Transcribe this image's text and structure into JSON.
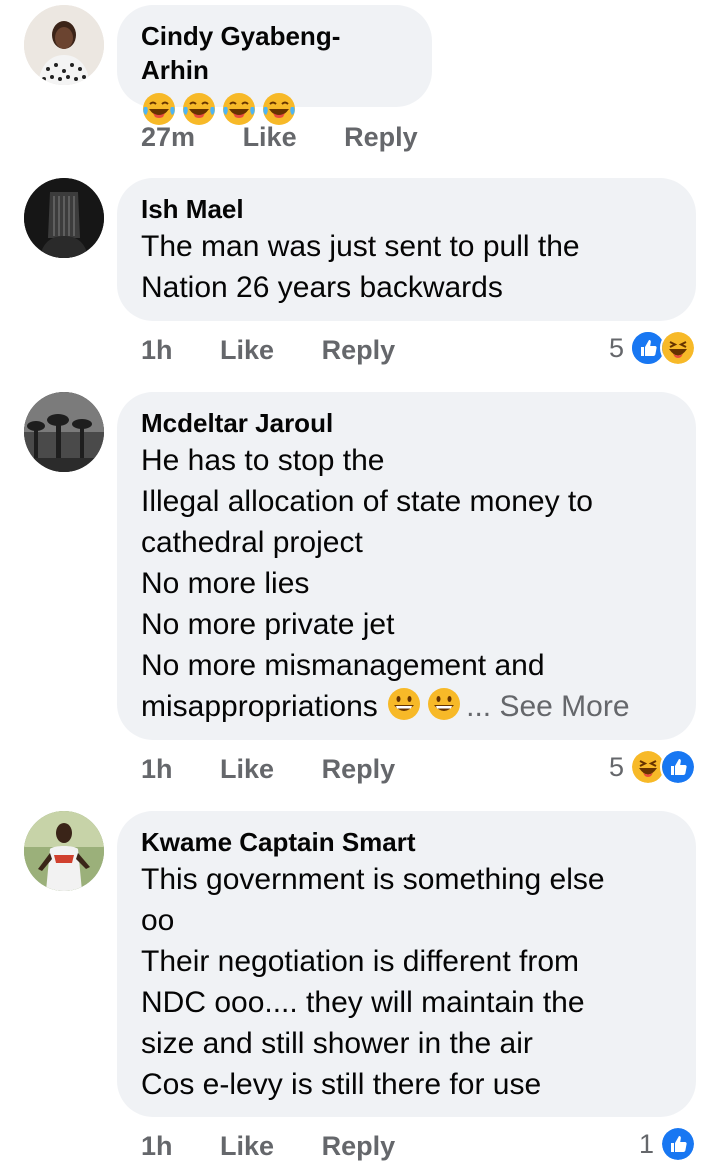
{
  "colors": {
    "bubble_bg": "#f0f2f5",
    "secondary_text": "#65676b",
    "like_blue": "#1877f2",
    "haha_yellow": "#f7b928"
  },
  "comments": [
    {
      "author": "Cindy Gyabeng-Arhin",
      "text": "",
      "emoji_only": [
        "laughing-tears-emoji",
        "laughing-tears-emoji",
        "laughing-tears-emoji",
        "laughing-tears-emoji"
      ],
      "time": "27m",
      "like": "Like",
      "reply": "Reply",
      "reaction_count": "",
      "reaction_icons": []
    },
    {
      "author": "Ish Mael",
      "text": "The man was just sent to pull the\nNation 26 years backwards",
      "time": "1h",
      "like": "Like",
      "reply": "Reply",
      "reaction_count": "5",
      "reaction_icons": [
        "like-icon",
        "haha-icon"
      ]
    },
    {
      "author": "Mcdeltar Jaroul",
      "text": "He has to stop the\nIllegal allocation of state money to\ncathedral project\nNo more lies\nNo more private jet\nNo more mismanagement and\nmisappropriations",
      "trailing_emojis": [
        "grinning-face-emoji",
        "grinning-face-emoji"
      ],
      "see_more": "... See More",
      "time": "1h",
      "like": "Like",
      "reply": "Reply",
      "reaction_count": "5",
      "reaction_icons": [
        "haha-icon",
        "like-icon"
      ]
    },
    {
      "author": "Kwame Captain Smart",
      "text": "This government is something else\noo\nTheir negotiation is different from\nNDC ooo.... they will maintain the\nsize and still shower in the air\nCos e-levy is still there for use",
      "time": "1h",
      "like": "Like",
      "reply": "Reply",
      "reaction_count": "1",
      "reaction_icons": [
        "like-icon"
      ]
    }
  ]
}
